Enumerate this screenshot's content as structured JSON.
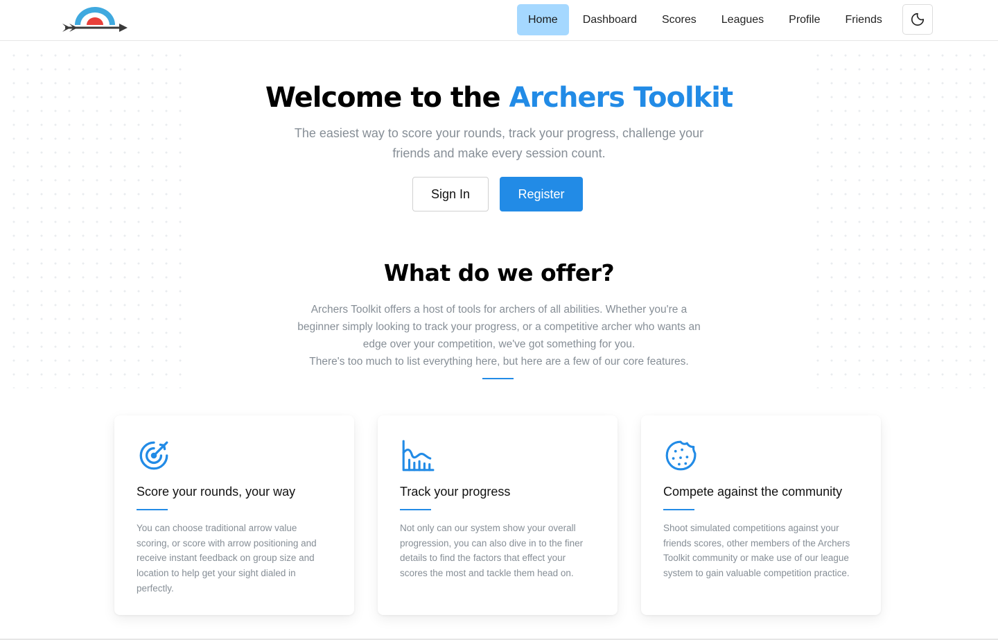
{
  "nav": {
    "items": [
      {
        "label": "Home",
        "active": true
      },
      {
        "label": "Dashboard",
        "active": false
      },
      {
        "label": "Scores",
        "active": false
      },
      {
        "label": "Leagues",
        "active": false
      },
      {
        "label": "Profile",
        "active": false
      },
      {
        "label": "Friends",
        "active": false
      }
    ],
    "theme_toggle_icon": "moon-icon"
  },
  "hero": {
    "title_prefix": "Welcome to the",
    "title_accent": "Archers Toolkit",
    "subtitle": "The easiest way to score your rounds, track your progress, challenge your friends and make every session count.",
    "signin_label": "Sign In",
    "register_label": "Register"
  },
  "offer": {
    "title": "What do we offer?",
    "description": "Archers Toolkit offers a host of tools for archers of all abilities. Whether you're a beginner simply looking to track your progress, or a competitive archer who wants an edge over your competition, we've got something for you.",
    "description_line2": "There's too much to list everything here, but here are a few of our core features."
  },
  "features": [
    {
      "icon": "target-arrow-icon",
      "title": "Score your rounds, your way",
      "description": "You can choose traditional arrow value scoring, or score with arrow positioning and receive instant feedback on group size and location to help get your sight dialed in perfectly."
    },
    {
      "icon": "chart-area-line-icon",
      "title": "Track your progress",
      "description": "Not only can our system show your overall progression, you can also dive in to the finer details to find the factors that effect your scores the most and tackle them head on."
    },
    {
      "icon": "cookie-icon",
      "title": "Compete against the community",
      "description": "Shoot simulated competitions against your friends scores, other members of the Archers Toolkit community or make use of our league system to gain valuable competition practice."
    }
  ],
  "colors": {
    "accent": "#228be6",
    "nav_active_bg": "#a5d8ff",
    "muted_text": "#868e96",
    "logo_arc": "#3fa9df",
    "logo_center": "#e8403a",
    "logo_arrow": "#3a3a3a"
  }
}
